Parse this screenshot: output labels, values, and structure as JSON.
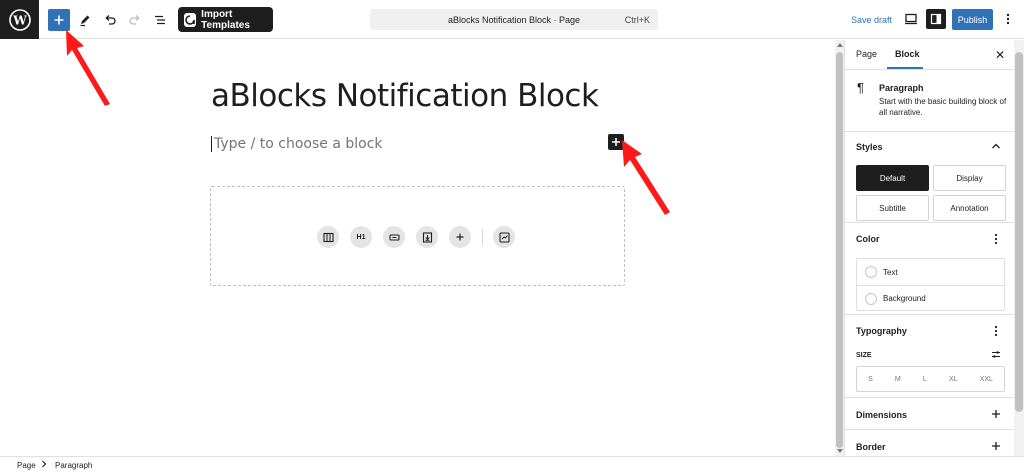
{
  "toolbar": {
    "import_templates_label": "Import Templates",
    "document_title": "aBlocks Notification Block · Page",
    "shortcut": "Ctrl+K",
    "save_draft_label": "Save draft",
    "publish_label": "Publish",
    "icons": [
      "wordpress-logo",
      "plus-icon",
      "pen-icon",
      "undo-icon",
      "redo-icon",
      "list-view-icon",
      "view-icon",
      "settings-icon",
      "more-vertical-icon"
    ]
  },
  "editor": {
    "title": "aBlocks Notification Block",
    "paragraph_placeholder": "Type / to choose a block",
    "ablocks_icons": [
      "columns-icon",
      "heading-icon",
      "button-icon",
      "download-icon",
      "plus-icon",
      "chart-icon"
    ],
    "heading_icon_text": "H1"
  },
  "sidebar": {
    "tabs": [
      "Page",
      "Block"
    ],
    "active_tab": "Block",
    "block_card": {
      "name": "Paragraph",
      "description": "Start with the basic building block of all narrative."
    },
    "styles": {
      "title": "Styles",
      "options": [
        "Default",
        "Display",
        "Subtitle",
        "Annotation"
      ],
      "active": "Default"
    },
    "color": {
      "title": "Color",
      "items": [
        "Text",
        "Background"
      ]
    },
    "typography": {
      "title": "Typography",
      "size_label": "SIZE",
      "sizes": [
        "S",
        "M",
        "L",
        "XL",
        "XXL"
      ]
    },
    "collapsed_panels": [
      "Dimensions",
      "Border"
    ]
  },
  "footer": {
    "breadcrumbs": [
      "Page",
      "Paragraph"
    ]
  },
  "colors": {
    "accent": "#3171b8",
    "dark": "#1e1e1e",
    "arrow": "#ff1a1a"
  }
}
